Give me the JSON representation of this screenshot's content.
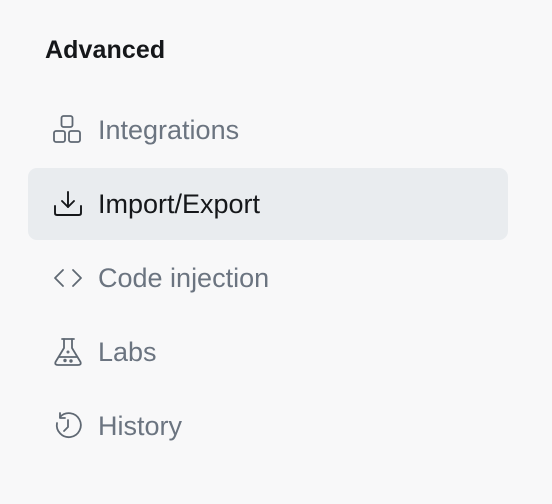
{
  "section": {
    "title": "Advanced"
  },
  "nav": {
    "items": [
      {
        "label": "Integrations",
        "icon": "integrations-icon",
        "active": false
      },
      {
        "label": "Import/Export",
        "icon": "import-export-icon",
        "active": true
      },
      {
        "label": "Code injection",
        "icon": "code-icon",
        "active": false
      },
      {
        "label": "Labs",
        "icon": "labs-flask-icon",
        "active": false
      },
      {
        "label": "History",
        "icon": "history-icon",
        "active": false
      }
    ]
  },
  "colors": {
    "background": "#f8f8f9",
    "active_background": "#e9ecef",
    "title": "#15171a",
    "inactive_text": "#6b7480",
    "active_text": "#15171a"
  }
}
